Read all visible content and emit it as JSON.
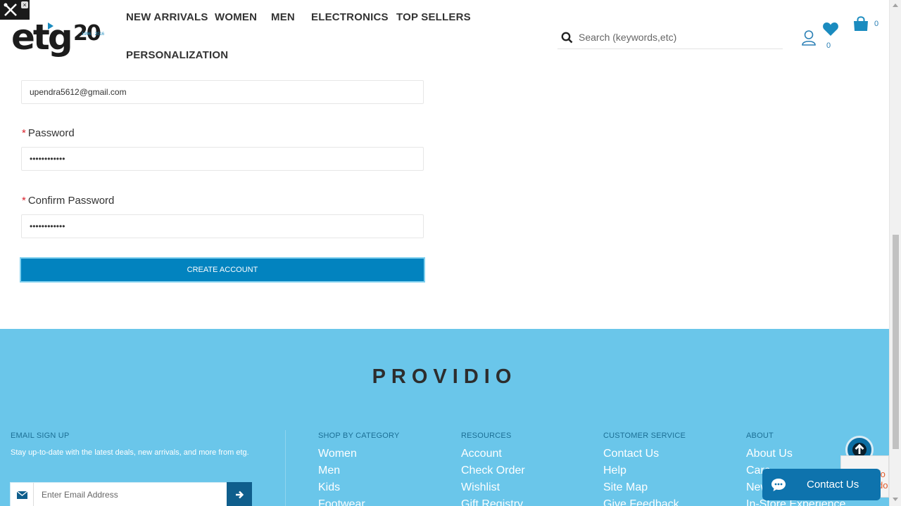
{
  "header": {
    "logo": {
      "text": "etg",
      "badge": "20",
      "years": "1996 · 2016"
    },
    "nav": [
      {
        "label": "NEW ARRIVALS"
      },
      {
        "label": "WOMEN"
      },
      {
        "label": "MEN"
      },
      {
        "label": "ELECTRONICS"
      },
      {
        "label": "TOP SELLERS"
      },
      {
        "label": "PERSONALIZATION"
      }
    ],
    "search": {
      "placeholder": "Search (keywords,etc)"
    },
    "wishlist_count": "0",
    "cart_count": "0"
  },
  "form": {
    "email_value": "upendra5612@gmail.com",
    "password_label": "Password",
    "password_value": "••••••••••••",
    "confirm_label": "Confirm Password",
    "confirm_value": "••••••••••••",
    "required_mark": "*",
    "submit_label": "CREATE ACCOUNT"
  },
  "footer": {
    "brand": "PROVIDIO",
    "signup": {
      "heading": "EMAIL SIGN UP",
      "text": "Stay up-to-date with the latest deals, new arrivals, and more from etg.",
      "placeholder": "Enter Email Address"
    },
    "columns": [
      {
        "heading": "SHOP BY CATEGORY",
        "links": [
          "Women",
          "Men",
          "Kids",
          "Footwear"
        ]
      },
      {
        "heading": "RESOURCES",
        "links": [
          "Account",
          "Check Order",
          "Wishlist",
          "Gift Registry"
        ]
      },
      {
        "heading": "CUSTOMER SERVICE",
        "links": [
          "Contact Us",
          "Help",
          "Site Map",
          "Give Feedback"
        ]
      },
      {
        "heading": "ABOUT",
        "links": [
          "About Us",
          "Care",
          "New",
          "In-Store Experience"
        ]
      }
    ]
  },
  "chat": {
    "label": "Contact Us"
  },
  "colors": {
    "accent": "#0283bf",
    "footer_bg": "#6ac6ea",
    "required": "#d9232d"
  }
}
